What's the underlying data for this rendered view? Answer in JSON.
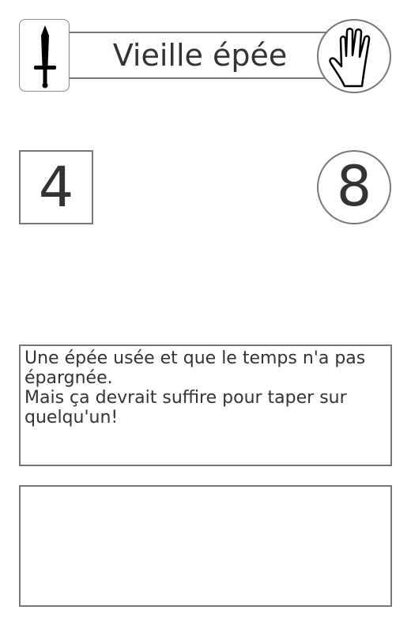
{
  "card": {
    "title": "Vieille épée",
    "type_icon": "sword-icon",
    "slot_icon": "hand-icon",
    "box_stat": "4",
    "circle_stat": "8",
    "description": [
      "Une épée usée et que le temps n'a pas",
      "épargnée.",
      "Mais ça devrait suffire pour taper sur",
      "quelqu'un!"
    ],
    "extra_text": ""
  },
  "colors": {
    "border": "#777777",
    "text": "#333333",
    "icon": "#000000",
    "background": "#ffffff"
  }
}
